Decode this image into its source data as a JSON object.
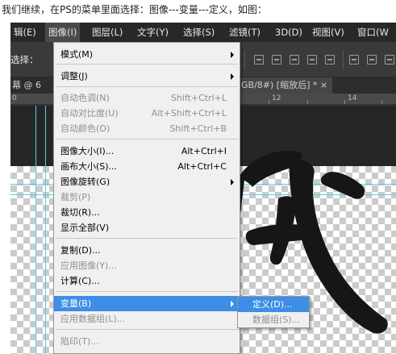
{
  "caption": "我们继续，在PS的菜单里面选择：图像---变量---定义，如图：",
  "menubar": [
    "辑(E)",
    "图像(I)",
    "图层(L)",
    "文字(Y)",
    "选择(S)",
    "滤镜(T)",
    "3D(D)",
    "视图(V)",
    "窗口(W"
  ],
  "options_bar": {
    "label": "选择："
  },
  "tabs": {
    "left": "幕 @ 6",
    "doc": "GB/8#) [缩放后] *",
    "close": "×"
  },
  "ruler": {
    "labels": [
      "0",
      "12",
      "14"
    ]
  },
  "image_menu": {
    "items": [
      {
        "label": "模式(M)",
        "shortcut": "",
        "submenu": true,
        "disabled": false
      },
      {
        "label": "调整(J)",
        "shortcut": "",
        "submenu": true,
        "disabled": false
      },
      {
        "label": "自动色调(N)",
        "shortcut": "Shift+Ctrl+L",
        "submenu": false,
        "disabled": true
      },
      {
        "label": "自动对比度(U)",
        "shortcut": "Alt+Shift+Ctrl+L",
        "submenu": false,
        "disabled": true
      },
      {
        "label": "自动颜色(O)",
        "shortcut": "Shift+Ctrl+B",
        "submenu": false,
        "disabled": true
      },
      {
        "label": "图像大小(I)...",
        "shortcut": "Alt+Ctrl+I",
        "submenu": false,
        "disabled": false
      },
      {
        "label": "画布大小(S)...",
        "shortcut": "Alt+Ctrl+C",
        "submenu": false,
        "disabled": false
      },
      {
        "label": "图像旋转(G)",
        "shortcut": "",
        "submenu": true,
        "disabled": false
      },
      {
        "label": "裁剪(P)",
        "shortcut": "",
        "submenu": false,
        "disabled": true
      },
      {
        "label": "裁切(R)...",
        "shortcut": "",
        "submenu": false,
        "disabled": false
      },
      {
        "label": "显示全部(V)",
        "shortcut": "",
        "submenu": false,
        "disabled": false
      },
      {
        "label": "复制(D)...",
        "shortcut": "",
        "submenu": false,
        "disabled": false
      },
      {
        "label": "应用图像(Y)...",
        "shortcut": "",
        "submenu": false,
        "disabled": true
      },
      {
        "label": "计算(C)...",
        "shortcut": "",
        "submenu": false,
        "disabled": false
      },
      {
        "label": "变量(B)",
        "shortcut": "",
        "submenu": true,
        "disabled": false,
        "highlighted": true
      },
      {
        "label": "应用数据组(L)...",
        "shortcut": "",
        "submenu": false,
        "disabled": true
      },
      {
        "label": "陷印(T)...",
        "shortcut": "",
        "submenu": false,
        "disabled": true
      }
    ]
  },
  "variables_submenu": {
    "items": [
      {
        "label": "定义(D)...",
        "disabled": false,
        "highlighted": true
      },
      {
        "label": "数据组(S)...",
        "disabled": true
      }
    ]
  },
  "colors": {
    "highlight": "#3d8ee6",
    "guide": "#4fd0e8",
    "menubar": "#282828"
  }
}
